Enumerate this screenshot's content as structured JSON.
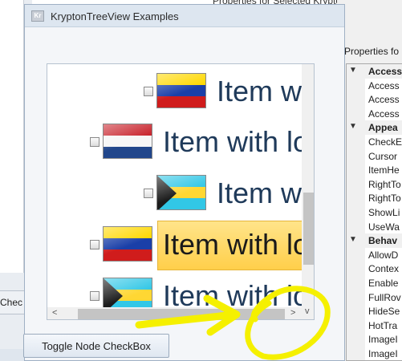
{
  "background": {
    "left_button_label": "Chec",
    "top_text": "Properties for Selected KryptonTreeView"
  },
  "window": {
    "title": "KryptonTreeView Examples",
    "app_icon_text": "Kr"
  },
  "tree": {
    "nodes": [
      {
        "text": "Item with long text",
        "flag": "venezuela-flag",
        "selected": false
      },
      {
        "text": "Item with long text",
        "flag": "netherlands-flag",
        "selected": false
      },
      {
        "text": "Item with long text",
        "flag": "bahamas-flag",
        "selected": false
      },
      {
        "text": "Item with long text",
        "flag": "venezuela-flag",
        "selected": true
      },
      {
        "text": "Item with long text",
        "flag": "bahamas-flag",
        "selected": false
      }
    ],
    "scroll_left_glyph": "<",
    "scroll_right_glyph": ">",
    "scroll_down_glyph": "v"
  },
  "toggle_button": {
    "label": "Toggle Node CheckBox"
  },
  "property_grid": {
    "label": "Properties fo",
    "rows": [
      {
        "type": "category",
        "text": "Access",
        "expander": "▼"
      },
      {
        "type": "item",
        "text": "Access"
      },
      {
        "type": "item",
        "text": "Access"
      },
      {
        "type": "item",
        "text": "Access"
      },
      {
        "type": "category",
        "text": "Appea",
        "expander": "▼"
      },
      {
        "type": "item",
        "text": "CheckE"
      },
      {
        "type": "item",
        "text": "Cursor"
      },
      {
        "type": "item",
        "text": "ItemHe"
      },
      {
        "type": "item",
        "text": "RightTo"
      },
      {
        "type": "item",
        "text": "RightTo"
      },
      {
        "type": "item",
        "text": "ShowLi"
      },
      {
        "type": "item",
        "text": "UseWa"
      },
      {
        "type": "category",
        "text": "Behav",
        "expander": "▼"
      },
      {
        "type": "item",
        "text": "AllowD"
      },
      {
        "type": "item",
        "text": "Contex"
      },
      {
        "type": "item",
        "text": "Enable"
      },
      {
        "type": "item",
        "text": "FullRov"
      },
      {
        "type": "item",
        "text": "HideSe"
      },
      {
        "type": "item",
        "text": "HotTra"
      },
      {
        "type": "item",
        "text": "ImageI"
      },
      {
        "type": "item",
        "text": "ImageI"
      }
    ]
  },
  "colors": {
    "annotation": "#f5f000",
    "selection": "#ffd866",
    "node_text": "#1f3a5a"
  }
}
